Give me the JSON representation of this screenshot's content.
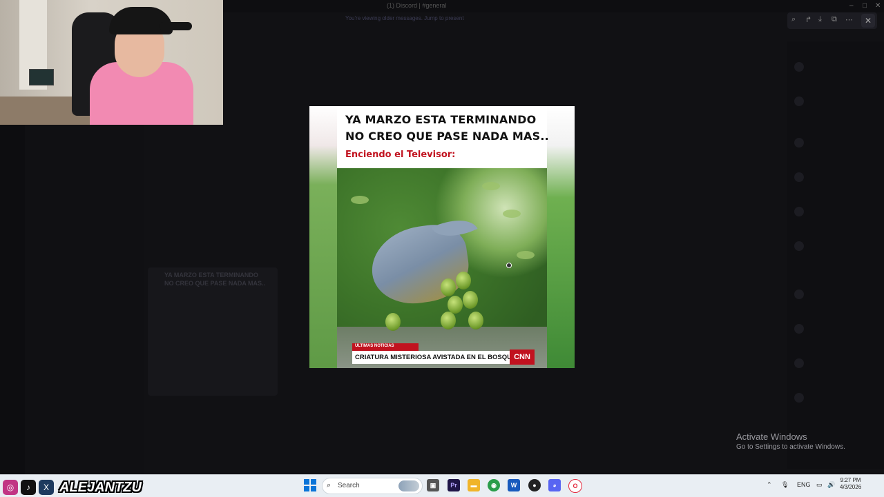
{
  "window": {
    "title": "(1) Discord | #general",
    "controls": {
      "minimize": "–",
      "maximize": "□",
      "close": "✕"
    },
    "notice": "You're viewing older messages. Jump to present"
  },
  "viewer": {
    "tools": [
      "zoom-icon",
      "share-icon",
      "download-icon",
      "open-icon",
      "more-icon"
    ],
    "close_label": "✕"
  },
  "meme": {
    "line1": "YA MARZO ESTA TERMINANDO",
    "line2": "NO CREO QUE PASE NADA MAS..",
    "subtitle": "Enciendo el Televisor:",
    "news_tag": "ULTIMAS NOTICIAS",
    "news_headline": "CRIATURA MISTERIOSA AVISTADA EN EL BOSQUE",
    "news_logo": "CNN"
  },
  "background_card": {
    "line1": "YA MARZO ESTA TERMINANDO",
    "line2": "NO CREO QUE PASE NADA MAS.."
  },
  "activation": {
    "title": "Activate Windows",
    "subtitle": "Go to Settings to activate Windows."
  },
  "overlay": {
    "handle": "ALEJANTZU",
    "icons": [
      "instagram-icon",
      "tiktok-icon",
      "x-icon"
    ]
  },
  "taskbar": {
    "search_label": "Search",
    "tray_lang": "ENG",
    "time": "9:27 PM",
    "date": "4/3/2026"
  },
  "colors": {
    "news_red": "#c1121f",
    "taskbar": "#e9eef3",
    "accent": "#0a74d8"
  }
}
